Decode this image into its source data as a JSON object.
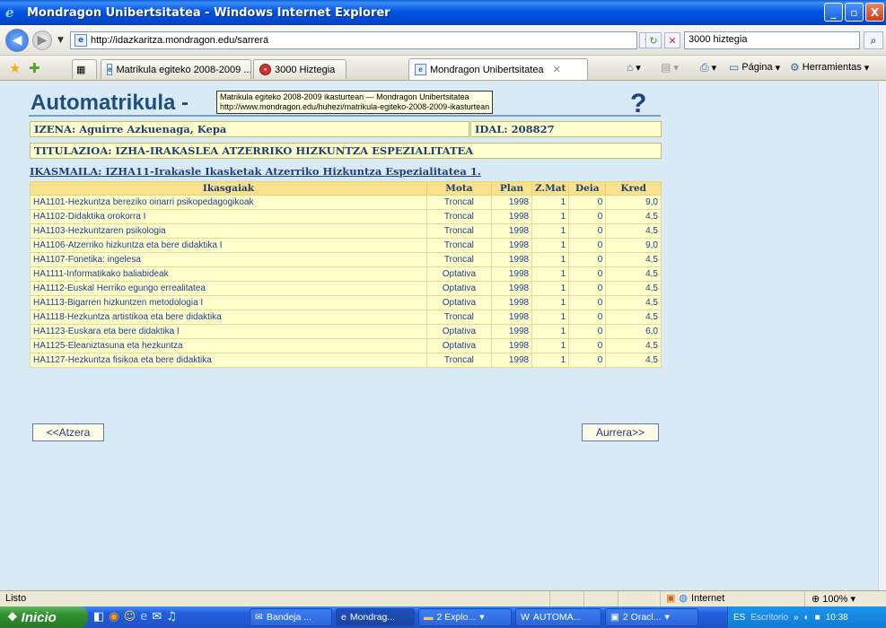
{
  "window": {
    "title": "Mondragon Unibertsitatea - Windows Internet Explorer",
    "min": "_",
    "max": "▫",
    "close": "X"
  },
  "nav": {
    "url": "http://idazkaritza.mondragon.edu/sarrera",
    "search_value": "3000 hiztegia"
  },
  "tabs": [
    {
      "label": "Matrikula egiteko 2008-2009 ..."
    },
    {
      "label": "3000 Hiztegia"
    },
    {
      "label": "Mondragon Unibertsitatea"
    }
  ],
  "toolbar": {
    "page_label": "Página",
    "tools_label": "Herramientas"
  },
  "page": {
    "title": "Automatrikula -",
    "tooltip_line1": "Matrikula egiteko 2008-2009 ikasturtean — Mondragon Unibertsitatea",
    "tooltip_line2": "http://www.mondragon.edu/huhezi/matrikula-egiteko-2008-2009-ikasturtean",
    "help_glyph": "?",
    "izena": "IZENA: Aguirre Azkuenaga, Kepa",
    "idal": "IDAL: 208827",
    "titulazioa": "TITULAZIOA: IZHA-IRAKASLEA ATZERRIKO HIZKUNTZA ESPEZIALITATEA",
    "ikasmaila": "IKASMAILA: IZHA11-Irakasle Ikasketak Atzerriko Hizkuntza Espezialitatea 1.",
    "back_button": "<<Atzera",
    "next_button": "Aurrera>>"
  },
  "table": {
    "headers": [
      "Ikasgaiak",
      "Mota",
      "Plan",
      "Z.Mat",
      "Deia",
      "Kred"
    ],
    "rows": [
      [
        "HA1101-Hezkuntza bereziko oinarri psikopedagogikoak",
        "Troncal",
        "1998",
        "1",
        "0",
        "9,0"
      ],
      [
        "HA1102-Didaktika orokorra I",
        "Troncal",
        "1998",
        "1",
        "0",
        "4,5"
      ],
      [
        "HA1103-Hezkuntzaren psikologia",
        "Troncal",
        "1998",
        "1",
        "0",
        "4,5"
      ],
      [
        "HA1106-Atzerriko hizkuntza eta bere didaktika I",
        "Troncal",
        "1998",
        "1",
        "0",
        "9,0"
      ],
      [
        "HA1107-Fonetika: ingelesa",
        "Troncal",
        "1998",
        "1",
        "0",
        "4,5"
      ],
      [
        "HA1111-Informatikako baliabideak",
        "Optativa",
        "1998",
        "1",
        "0",
        "4,5"
      ],
      [
        "HA1112-Euskal Herriko egungo errealitatea",
        "Optativa",
        "1998",
        "1",
        "0",
        "4,5"
      ],
      [
        "HA1113-Bigarren hizkuntzen metodologia I",
        "Optativa",
        "1998",
        "1",
        "0",
        "4,5"
      ],
      [
        "HA1118-Hezkuntza artistikoa eta bere didaktika",
        "Troncal",
        "1998",
        "1",
        "0",
        "4,5"
      ],
      [
        "HA1123-Euskara eta bere didaktika I",
        "Optativa",
        "1998",
        "1",
        "0",
        "6,0"
      ],
      [
        "HA1125-Eleaniztasuna eta hezkuntza",
        "Optativa",
        "1998",
        "1",
        "0",
        "4,5"
      ],
      [
        "HA1127-Hezkuntza fisikoa eta bere didaktika",
        "Troncal",
        "1998",
        "1",
        "0",
        "4,5"
      ]
    ]
  },
  "status": {
    "text": "Listo",
    "zone": "Internet",
    "zoom": "100%"
  },
  "taskbar": {
    "start": "Inicio",
    "tasks": [
      "Bandeja ...",
      "Mondrag...",
      "2 Explo...",
      "AUTOMA...",
      "2 Oracl..."
    ],
    "lang": "ES",
    "desktop": "Escritorio",
    "clock": "10:38"
  }
}
